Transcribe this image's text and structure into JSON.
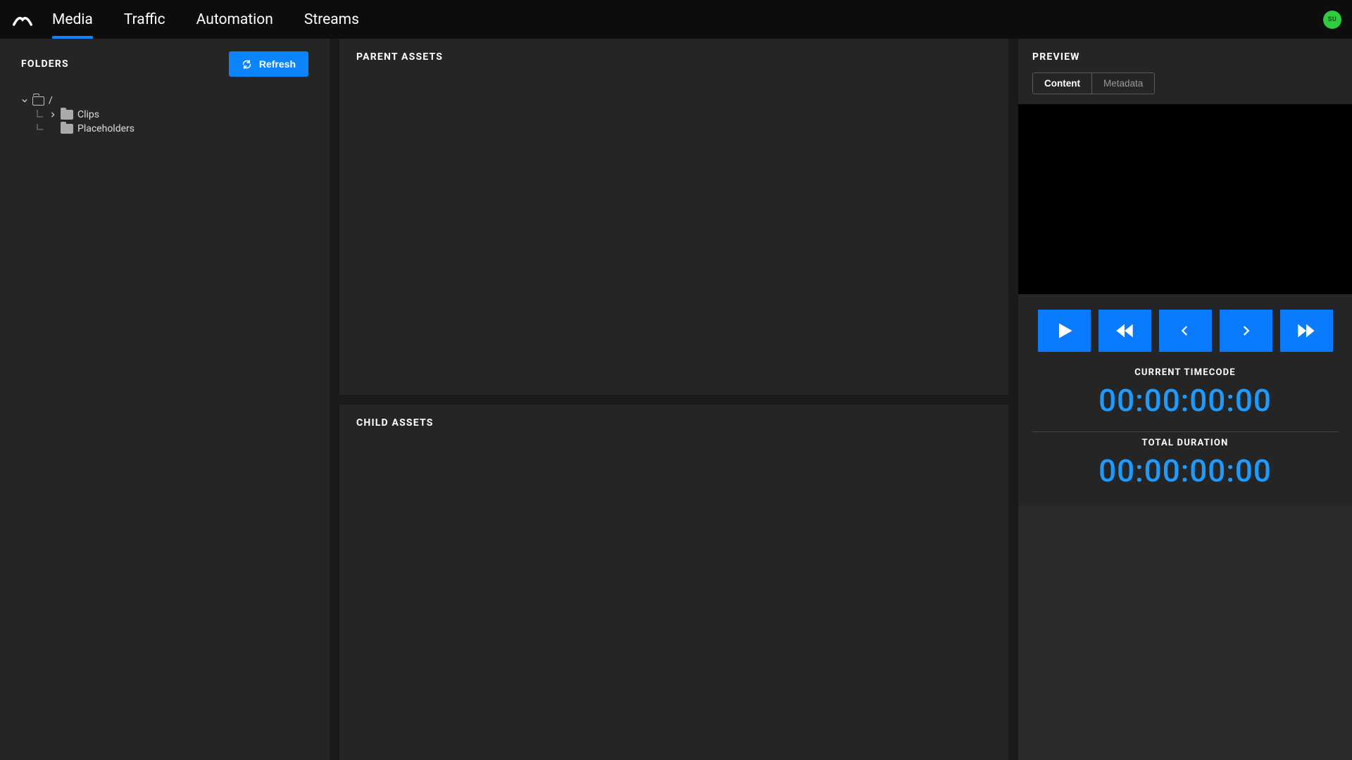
{
  "nav": {
    "tabs": [
      "Media",
      "Traffic",
      "Automation",
      "Streams"
    ],
    "activeIndex": 0
  },
  "avatar": {
    "initials": "SU"
  },
  "folders": {
    "title": "FOLDERS",
    "refreshLabel": "Refresh",
    "tree": {
      "rootLabel": "/",
      "children": [
        {
          "label": "Clips",
          "hasChildren": true
        },
        {
          "label": "Placeholders",
          "hasChildren": false
        }
      ]
    }
  },
  "parentAssets": {
    "title": "PARENT ASSETS"
  },
  "childAssets": {
    "title": "CHILD ASSETS"
  },
  "preview": {
    "title": "PREVIEW",
    "tabs": {
      "content": "Content",
      "metadata": "Metadata",
      "active": "content"
    },
    "currentTimecode": {
      "label": "CURRENT TIMECODE",
      "value": "00:00:00:00"
    },
    "totalDuration": {
      "label": "TOTAL DURATION",
      "value": "00:00:00:00"
    }
  }
}
